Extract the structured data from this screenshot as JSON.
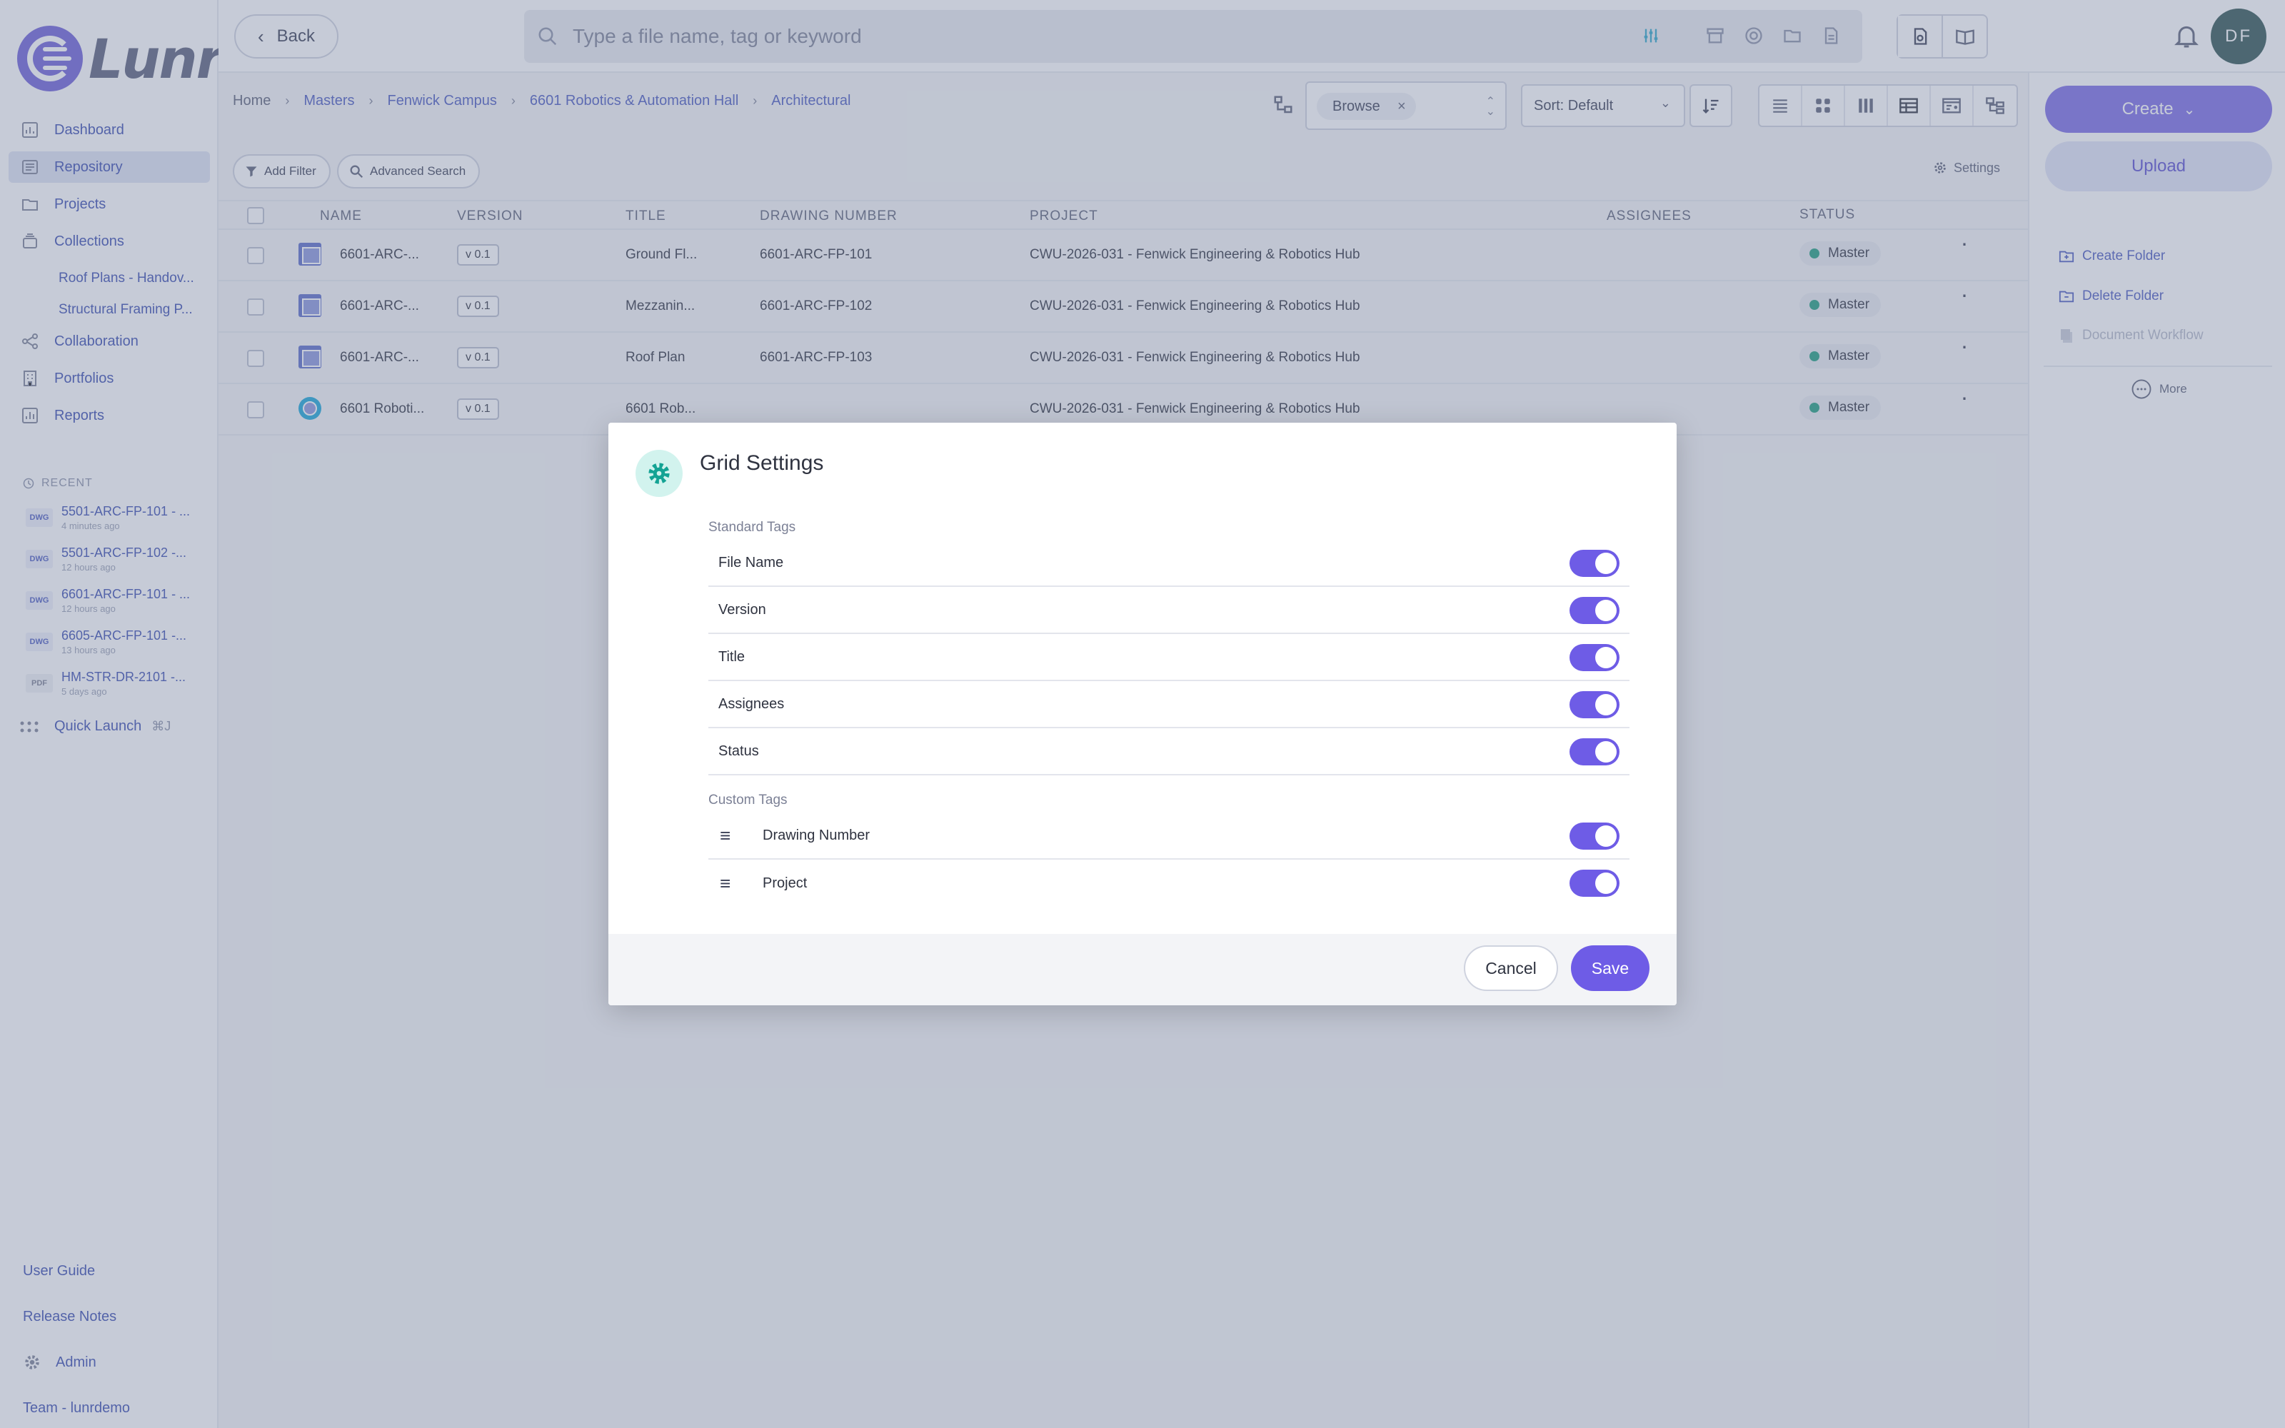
{
  "app": {
    "logo_text": "Lunr"
  },
  "sidebar": {
    "items": [
      {
        "label": "Dashboard",
        "icon": "chart-icon"
      },
      {
        "label": "Repository",
        "icon": "repository-icon"
      },
      {
        "label": "Projects",
        "icon": "folder-icon"
      },
      {
        "label": "Collections",
        "icon": "collections-icon"
      }
    ],
    "collections": [
      "Roof Plans - Handov...",
      "Structural Framing P..."
    ],
    "items2": [
      {
        "label": "Collaboration",
        "icon": "share-icon"
      },
      {
        "label": "Portfolios",
        "icon": "portfolio-icon"
      },
      {
        "label": "Reports",
        "icon": "report-icon"
      }
    ],
    "recent_label": "RECENT",
    "recent": [
      {
        "type": "DWG",
        "name": "5501-ARC-FP-101 - ...",
        "time": "4 minutes ago"
      },
      {
        "type": "DWG",
        "name": "5501-ARC-FP-102 -...",
        "time": "12 hours ago"
      },
      {
        "type": "DWG",
        "name": "6601-ARC-FP-101 - ...",
        "time": "12 hours ago"
      },
      {
        "type": "DWG",
        "name": "6605-ARC-FP-101 -...",
        "time": "13 hours ago"
      },
      {
        "type": "PDF",
        "name": "HM-STR-DR-2101 -...",
        "time": "5 days ago"
      }
    ],
    "quick_launch": "Quick Launch",
    "quick_launch_kbd": "⌘J",
    "bottom": [
      "User Guide",
      "Release Notes",
      "Admin",
      "Team - lunrdemo"
    ]
  },
  "topbar": {
    "back": "Back",
    "search_placeholder": "Type a file name, tag or keyword",
    "avatar": "DF"
  },
  "breadcrumb": [
    "Home",
    "Masters",
    "Fenwick Campus",
    "6601 Robotics & Automation Hall",
    "Architectural"
  ],
  "toolbar": {
    "browse_chip": "Browse",
    "sort": "Sort: Default",
    "add_filter": "Add Filter",
    "advanced_search": "Advanced Search",
    "settings": "Settings"
  },
  "table": {
    "headers": [
      "NAME",
      "VERSION",
      "TITLE",
      "DRAWING NUMBER",
      "PROJECT",
      "ASSIGNEES",
      "STATUS"
    ],
    "rows": [
      {
        "name": "6601-ARC-...",
        "version": "v 0.1",
        "title": "Ground Fl...",
        "drawing": "6601-ARC-FP-101",
        "project": "CWU-2026-031 - Fenwick Engineering & Robotics Hub",
        "status": "Master",
        "thumb": "drawing"
      },
      {
        "name": "6601-ARC-...",
        "version": "v 0.1",
        "title": "Mezzanin...",
        "drawing": "6601-ARC-FP-102",
        "project": "CWU-2026-031 - Fenwick Engineering & Robotics Hub",
        "status": "Master",
        "thumb": "drawing"
      },
      {
        "name": "6601-ARC-...",
        "version": "v 0.1",
        "title": "Roof Plan",
        "drawing": "6601-ARC-FP-103",
        "project": "CWU-2026-031 - Fenwick Engineering & Robotics Hub",
        "status": "Master",
        "thumb": "drawing"
      },
      {
        "name": "6601 Roboti...",
        "version": "v 0.1",
        "title": "6601 Rob...",
        "drawing": "",
        "project": "CWU-2026-031 - Fenwick Engineering & Robotics Hub",
        "status": "Master",
        "thumb": "model"
      }
    ]
  },
  "right_panel": {
    "create": "Create",
    "upload": "Upload",
    "links": [
      "Create Folder",
      "Delete Folder",
      "Document Workflow"
    ],
    "more": "More"
  },
  "modal": {
    "title": "Grid Settings",
    "standard_label": "Standard Tags",
    "standard": [
      "File Name",
      "Version",
      "Title",
      "Assignees",
      "Status"
    ],
    "custom_label": "Custom Tags",
    "custom": [
      "Drawing Number",
      "Project"
    ],
    "cancel": "Cancel",
    "save": "Save"
  },
  "colors": {
    "accent": "#6e5ce6",
    "link": "#4b5bc0",
    "status_master": "#1e9e7e"
  }
}
